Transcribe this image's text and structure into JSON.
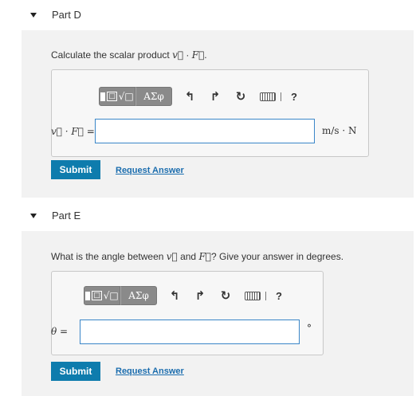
{
  "part_d": {
    "title": "Part D",
    "prompt_prefix": "Calculate the scalar product ",
    "vec_v": "v⃗",
    "dot": " · ",
    "vec_f": "F⃗",
    "prompt_suffix": ".",
    "lhs": "v⃗ · F⃗ =",
    "input_value": "",
    "units": "m/s · N",
    "submit_label": "Submit",
    "request_answer_label": "Request Answer"
  },
  "part_e": {
    "title": "Part E",
    "prompt_prefix": "What is the angle between ",
    "vec_v": "v⃗",
    "and": " and ",
    "vec_f": "F⃗",
    "prompt_suffix": "? Give your answer in degrees.",
    "lhs": "θ =",
    "input_value": "",
    "units": "°",
    "submit_label": "Submit",
    "request_answer_label": "Request Answer"
  },
  "toolbar": {
    "templates_root": "√□",
    "templates_frac": "□",
    "symbols_label": "ΑΣφ",
    "undo_icon": "↰",
    "redo_icon": "↱",
    "reset_icon": "↻",
    "help_label": "?"
  }
}
